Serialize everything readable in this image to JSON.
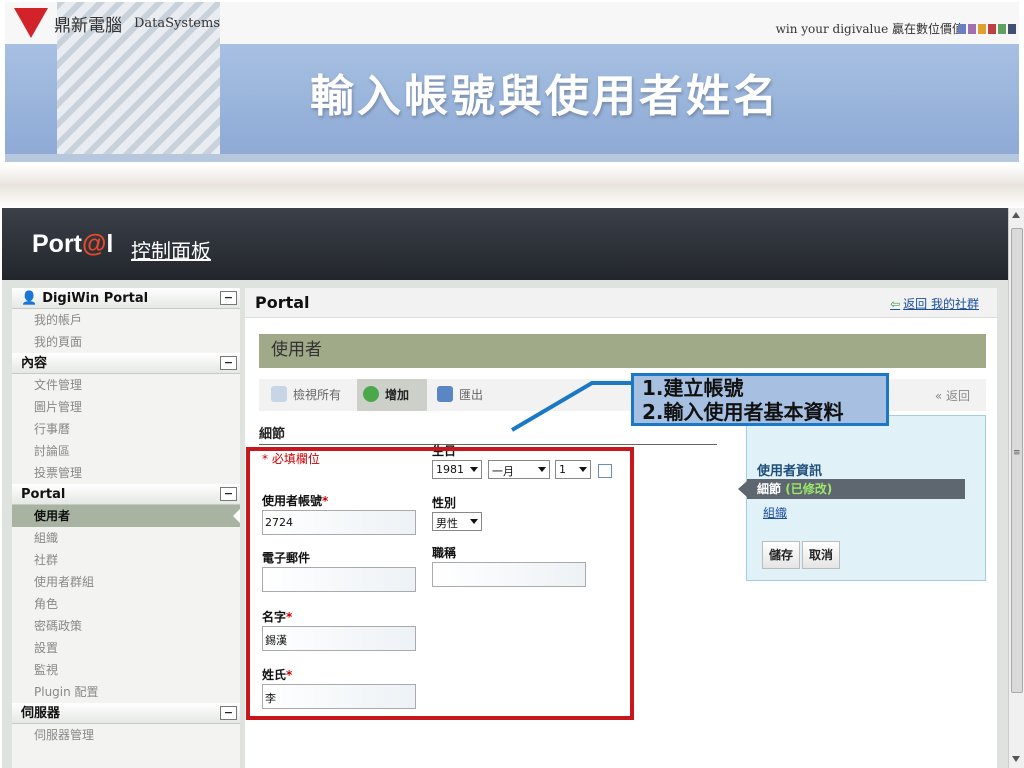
{
  "banner": {
    "logo_text": "鼎新電腦",
    "logo_sub": "DataSystems",
    "slogan": "win your digivalue 贏在數位價值",
    "swatch_colors": [
      "#6a7fc1",
      "#a070b0",
      "#e0a030",
      "#c04040",
      "#60a060",
      "#405070"
    ],
    "title": "輸入帳號與使用者姓名"
  },
  "app": {
    "logo": "Port@l",
    "title": "控制面板"
  },
  "sidebar": {
    "sections": [
      {
        "title": "DigiWin Portal",
        "icon": "user-icon",
        "items": [
          "我的帳戶",
          "我的頁面"
        ]
      },
      {
        "title": "內容",
        "items": [
          "文件管理",
          "圖片管理",
          "行事曆",
          "討論區",
          "投票管理"
        ]
      },
      {
        "title": "Portal",
        "items": [
          "使用者",
          "組織",
          "社群",
          "使用者群組",
          "角色",
          "密碼政策",
          "設置",
          "監視",
          "Plugin 配置"
        ],
        "active": "使用者"
      },
      {
        "title": "伺服器",
        "items": [
          "伺服器管理"
        ]
      }
    ],
    "collapse_label": "−"
  },
  "main": {
    "portal_title": "Portal",
    "back_link": "返回 我的社群",
    "section_header": "使用者",
    "toolbar": {
      "view_all": "檢視所有",
      "add": "增加",
      "export": "匯出",
      "back": "« 返回"
    },
    "details_title": "細節",
    "required_note": "必填欄位",
    "fields": {
      "screen_name_label": "使用者帳號",
      "screen_name_value": "2724",
      "email_label": "電子郵件",
      "email_value": "",
      "first_name_label": "名字",
      "first_name_value": "錫漢",
      "last_name_label": "姓氏",
      "last_name_value": "李",
      "birthday_label": "生日",
      "birthday_year": "1981",
      "birthday_month": "一月",
      "birthday_day": "1",
      "gender_label": "性別",
      "gender_value": "男性",
      "job_title_label": "職稱",
      "job_title_value": ""
    },
    "side_panel": {
      "title": "使用者資訊",
      "active_item": "細節",
      "active_modified": "(已修改)",
      "link": "組織",
      "save": "儲存",
      "cancel": "取消"
    }
  },
  "callout": {
    "line1": "1.建立帳號",
    "line2": "2.輸入使用者基本資料"
  }
}
